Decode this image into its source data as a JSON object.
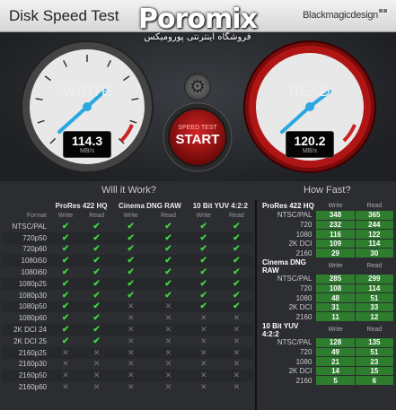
{
  "window": {
    "title": "Disk Speed Test",
    "brand": "Blackmagicdesign"
  },
  "watermark": {
    "name": "Poromix",
    "subtitle": "فروشگاه اینترنتی پورومیکس"
  },
  "gauges": {
    "write": {
      "label": "WRITE",
      "value": "114.3",
      "unit": "MB/s"
    },
    "read": {
      "label": "READ",
      "value": "120.2",
      "unit": "MB/s"
    }
  },
  "start_button": {
    "small": "SPEED TEST",
    "big": "START"
  },
  "will_it_work": {
    "title": "Will it Work?",
    "format_label": "Format",
    "codecs": [
      "ProRes 422 HQ",
      "Cinema DNG RAW",
      "10 Bit YUV 4:2:2"
    ],
    "col_write": "Write",
    "col_read": "Read",
    "rows": [
      {
        "format": "NTSC/PAL",
        "values": [
          1,
          1,
          1,
          1,
          1,
          1
        ]
      },
      {
        "format": "720p50",
        "values": [
          1,
          1,
          1,
          1,
          1,
          1
        ]
      },
      {
        "format": "720p60",
        "values": [
          1,
          1,
          1,
          1,
          1,
          1
        ]
      },
      {
        "format": "1080i50",
        "values": [
          1,
          1,
          1,
          1,
          1,
          1
        ]
      },
      {
        "format": "1080i60",
        "values": [
          1,
          1,
          1,
          1,
          1,
          1
        ]
      },
      {
        "format": "1080p25",
        "values": [
          1,
          1,
          1,
          1,
          1,
          1
        ]
      },
      {
        "format": "1080p30",
        "values": [
          1,
          1,
          1,
          1,
          1,
          1
        ]
      },
      {
        "format": "1080p50",
        "values": [
          1,
          1,
          0,
          0,
          1,
          1
        ]
      },
      {
        "format": "1080p60",
        "values": [
          1,
          1,
          0,
          0,
          0,
          0
        ]
      },
      {
        "format": "2K DCI 24",
        "values": [
          1,
          1,
          0,
          0,
          0,
          0
        ]
      },
      {
        "format": "2K DCI 25",
        "values": [
          1,
          1,
          0,
          0,
          0,
          0
        ]
      },
      {
        "format": "2160p25",
        "values": [
          0,
          0,
          0,
          0,
          0,
          0
        ]
      },
      {
        "format": "2160p30",
        "values": [
          0,
          0,
          0,
          0,
          0,
          0
        ]
      },
      {
        "format": "2160p50",
        "values": [
          0,
          0,
          0,
          0,
          0,
          0
        ]
      },
      {
        "format": "2160p60",
        "values": [
          0,
          0,
          0,
          0,
          0,
          0
        ]
      }
    ]
  },
  "how_fast": {
    "title": "How Fast?",
    "col_write": "Write",
    "col_read": "Read",
    "groups": [
      {
        "name": "ProRes 422 HQ",
        "rows": [
          {
            "format": "NTSC/PAL",
            "write": "348",
            "read": "365"
          },
          {
            "format": "720",
            "write": "232",
            "read": "244"
          },
          {
            "format": "1080",
            "write": "116",
            "read": "122"
          },
          {
            "format": "2K DCI",
            "write": "109",
            "read": "114"
          },
          {
            "format": "2160",
            "write": "29",
            "read": "30"
          }
        ]
      },
      {
        "name": "Cinema DNG RAW",
        "rows": [
          {
            "format": "NTSC/PAL",
            "write": "285",
            "read": "299"
          },
          {
            "format": "720",
            "write": "108",
            "read": "114"
          },
          {
            "format": "1080",
            "write": "48",
            "read": "51"
          },
          {
            "format": "2K DCI",
            "write": "31",
            "read": "33"
          },
          {
            "format": "2160",
            "write": "11",
            "read": "12"
          }
        ]
      },
      {
        "name": "10 Bit YUV 4:2:2",
        "rows": [
          {
            "format": "NTSC/PAL",
            "write": "128",
            "read": "135"
          },
          {
            "format": "720",
            "write": "49",
            "read": "51"
          },
          {
            "format": "1080",
            "write": "21",
            "read": "23"
          },
          {
            "format": "2K DCI",
            "write": "14",
            "read": "15"
          },
          {
            "format": "2160",
            "write": "5",
            "read": "6"
          }
        ]
      }
    ]
  }
}
